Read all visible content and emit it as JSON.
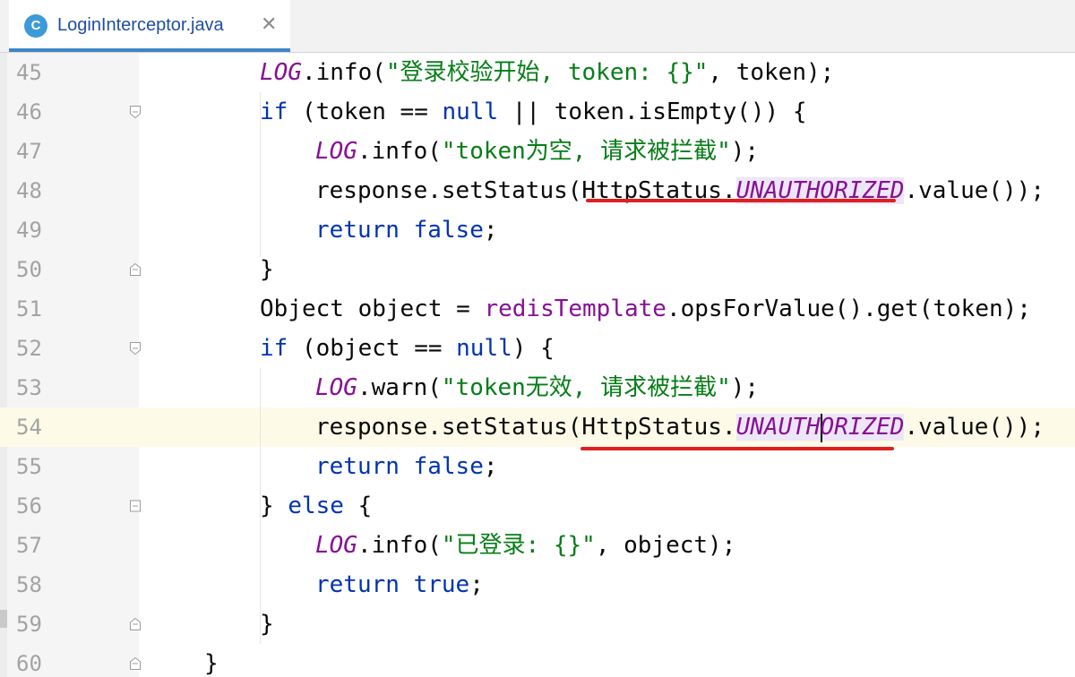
{
  "tab": {
    "icon_letter": "C",
    "title": "LoginInterceptor.java",
    "close": "✕"
  },
  "editor": {
    "current_line": "54",
    "lines": [
      {
        "num": "45",
        "segs": [
          [
            "f",
            "LOG"
          ],
          [
            "",
            "."
          ],
          [
            "",
            "info("
          ],
          [
            "s",
            "\"登录校验开始, token: {}\""
          ],
          [
            "",
            ", token);"
          ]
        ]
      },
      {
        "num": "46",
        "segs": [
          [
            "k",
            "if"
          ],
          [
            "",
            " (token == "
          ],
          [
            "k",
            "null"
          ],
          [
            "",
            " || token.isEmpty()) {"
          ]
        ]
      },
      {
        "num": "47",
        "segs": [
          [
            "f",
            "LOG"
          ],
          [
            "",
            ".info("
          ],
          [
            "s",
            "\"token为空, 请求被拦截\""
          ],
          [
            "",
            ");"
          ]
        ]
      },
      {
        "num": "48",
        "segs": [
          [
            "",
            "response.setStatus(HttpStatus."
          ],
          [
            "f",
            "UNAUTHORIZED"
          ],
          [
            "",
            ".value());"
          ]
        ]
      },
      {
        "num": "49",
        "segs": [
          [
            "k",
            "return"
          ],
          [
            "k",
            " false"
          ],
          [
            "",
            ";"
          ]
        ]
      },
      {
        "num": "50",
        "segs": [
          [
            "",
            "}"
          ]
        ]
      },
      {
        "num": "51",
        "segs": [
          [
            "",
            "Object object = "
          ],
          [
            "fi",
            "redisTemplate"
          ],
          [
            "",
            ".opsForValue().get(token);"
          ]
        ]
      },
      {
        "num": "52",
        "segs": [
          [
            "k",
            "if"
          ],
          [
            "",
            " (object == "
          ],
          [
            "k",
            "null"
          ],
          [
            "",
            ") {"
          ]
        ]
      },
      {
        "num": "53",
        "segs": [
          [
            "f",
            "LOG"
          ],
          [
            "",
            ".warn("
          ],
          [
            "s",
            "\"token无效, 请求被拦截\""
          ],
          [
            "",
            ");"
          ]
        ]
      },
      {
        "num": "54",
        "segs": [
          [
            "",
            "response.setStatus(HttpStatus."
          ],
          [
            "f",
            "UNAUTHORIZED"
          ],
          [
            "",
            ".value());"
          ]
        ]
      },
      {
        "num": "55",
        "segs": [
          [
            "k",
            "return"
          ],
          [
            "k",
            " false"
          ],
          [
            "",
            ";"
          ]
        ]
      },
      {
        "num": "56",
        "segs": [
          [
            "",
            "} "
          ],
          [
            "k",
            "else"
          ],
          [
            "",
            " {"
          ]
        ]
      },
      {
        "num": "57",
        "segs": [
          [
            "f",
            "LOG"
          ],
          [
            "",
            ".info("
          ],
          [
            "s",
            "\"已登录: {}\""
          ],
          [
            "",
            ", object);"
          ]
        ]
      },
      {
        "num": "58",
        "segs": [
          [
            "k",
            "return"
          ],
          [
            "k",
            " true"
          ],
          [
            "",
            ";"
          ]
        ]
      },
      {
        "num": "59",
        "segs": [
          [
            "",
            "}"
          ]
        ]
      },
      {
        "num": "60",
        "segs": [
          [
            "",
            "}"
          ]
        ]
      }
    ]
  },
  "colors": {
    "keyword": "#0033b3",
    "string": "#067d17",
    "field": "#871094",
    "underline": "#e02020",
    "tab_accent": "#3e86c6"
  },
  "icons": {
    "file_type": "class-icon",
    "fold": "fold-marker-icon"
  }
}
